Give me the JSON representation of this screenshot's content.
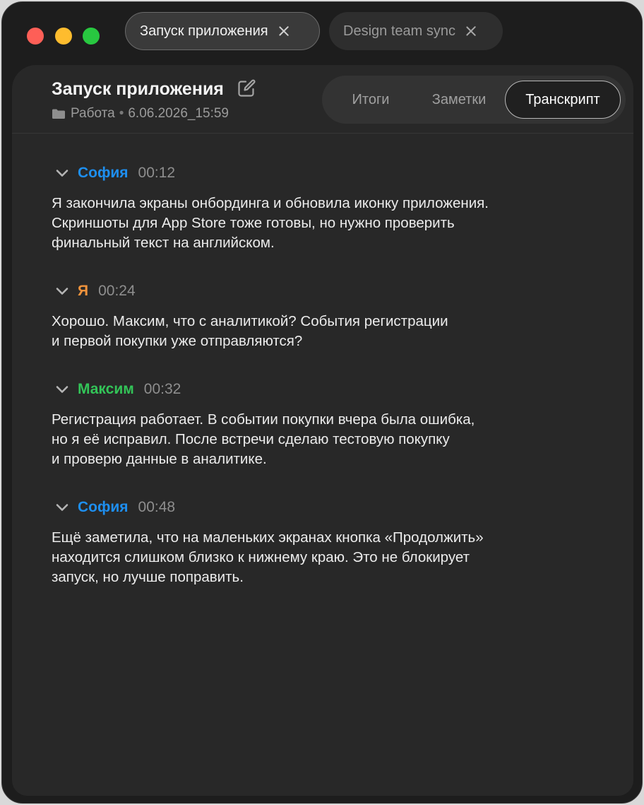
{
  "window": {
    "controls": [
      "close",
      "minimize",
      "maximize"
    ]
  },
  "tabs": [
    {
      "label": "Запуск приложения",
      "active": true
    },
    {
      "label": "Design team sync",
      "active": false
    }
  ],
  "header": {
    "title": "Запуск приложения",
    "folder": "Работа",
    "separator": "•",
    "datetime": "6.06.2026_15:59",
    "icons": [
      "edit-icon",
      "folder-icon"
    ]
  },
  "segments": {
    "items": [
      "Итоги",
      "Заметки",
      "Транскрипт"
    ],
    "selected": "Транскрипт"
  },
  "colors": {
    "sofia": "#1e8ff0",
    "me": "#f0933c",
    "maxim": "#33c458"
  },
  "transcript": [
    {
      "speaker": "София",
      "time": "00:12",
      "color": "#1e8ff0",
      "text": "Я закончила экраны онбординга и обновила иконку приложения.\nСкриншоты для App Store тоже готовы, но нужно проверить\nфинальный текст на английском."
    },
    {
      "speaker": "Я",
      "time": "00:24",
      "color": "#f0933c",
      "text": "Хорошо. Максим, что с аналитикой? События регистрации\nи первой покупки уже отправляются?"
    },
    {
      "speaker": "Максим",
      "time": "00:32",
      "color": "#33c458",
      "text": "Регистрация работает. В событии покупки вчера была ошибка,\nно я её исправил. После встречи сделаю тестовую покупку\nи проверю данные в аналитике."
    },
    {
      "speaker": "София",
      "time": "00:48",
      "color": "#1e8ff0",
      "text": "Ещё заметила, что на маленьких экранах кнопка «Продолжить»\nнаходится слишком близко к нижнему краю. Это не блокирует\nзапуск, но лучше поправить."
    }
  ]
}
